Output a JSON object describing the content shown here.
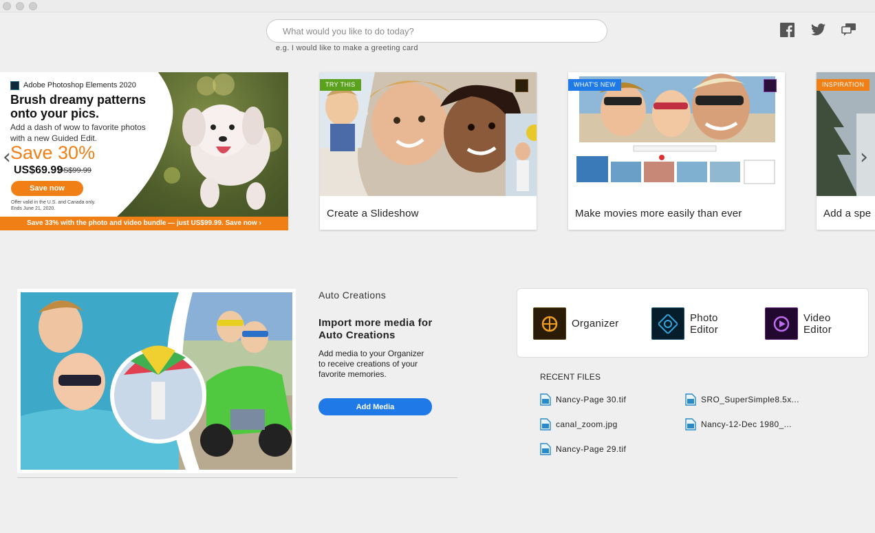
{
  "search": {
    "placeholder": "What would you like to do today?",
    "hint": "e.g. I would like to make a greeting card"
  },
  "social": {
    "facebook": "facebook-icon",
    "twitter": "twitter-icon",
    "feedback": "feedback-icon"
  },
  "promo": {
    "product": "Adobe Photoshop Elements 2020",
    "headline": "Brush dreamy patterns onto your pics.",
    "sub": "Add a dash of wow to favorite photos with a new Guided Edit.",
    "save": "Save 30%",
    "price": "US$69.99",
    "old_price": "US$99.99",
    "button": "Save now",
    "fine_print": "Offer valid in the U.S. and Canada only. Ends June 21, 2020.",
    "bar": "Save 33% with the photo and video bundle — just US$99.99.  Save now ›",
    "accent": "#f07f16"
  },
  "cards": [
    {
      "badge": "TRY THIS",
      "badge_color": "#5aa21e",
      "title": "Create a Slideshow"
    },
    {
      "badge": "WHAT'S NEW",
      "badge_color": "#1f7ae8",
      "title": "Make movies more easily than ever"
    },
    {
      "badge": "INSPIRATION",
      "badge_color": "#f07f16",
      "title": "Add a spe"
    }
  ],
  "auto_creations": {
    "section": "Auto Creations",
    "heading": "Import more media for Auto Creations",
    "body": "Add media to your Organizer to receive creations of your favorite memories.",
    "button": "Add Media"
  },
  "apps": [
    {
      "label": "Organizer",
      "icon": "organizer-icon",
      "color": "#f0a020"
    },
    {
      "label": "Photo\nEditor",
      "icon": "photo-editor-icon",
      "color": "#31a8e0"
    },
    {
      "label": "Video\nEditor",
      "icon": "video-editor-icon",
      "color": "#c06cf0"
    }
  ],
  "recent": {
    "title": "RECENT FILES",
    "files": [
      "Nancy-Page 30.tif",
      "SRO_SuperSimple8.5x...",
      "canal_zoom.jpg",
      "Nancy-12-Dec 1980_...",
      "Nancy-Page 29.tif"
    ]
  }
}
